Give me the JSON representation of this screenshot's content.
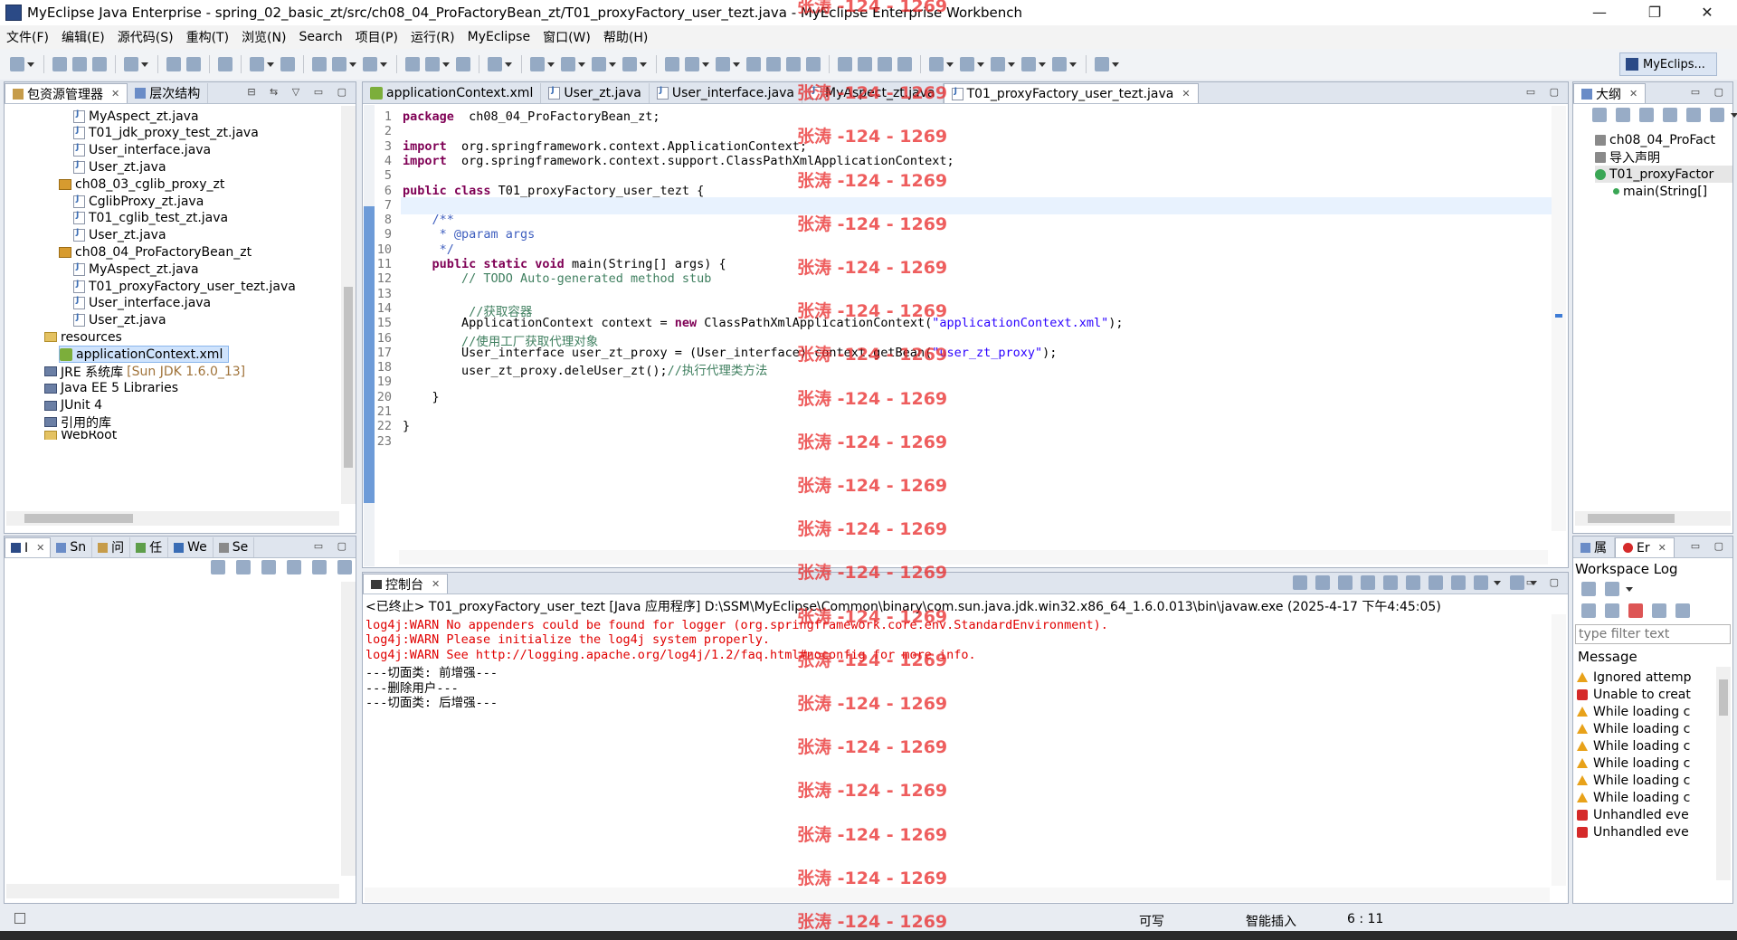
{
  "window": {
    "title": "MyEclipse Java Enterprise  -  spring_02_basic_zt/src/ch08_04_ProFactoryBean_zt/T01_proxyFactory_user_tezt.java  -  MyEclipse Enterprise Workbench",
    "minimize": "—",
    "restore": "❐",
    "close": "✕"
  },
  "menu": [
    "文件(F)",
    "编辑(E)",
    "源代码(S)",
    "重构(T)",
    "浏览(N)",
    "Search",
    "项目(P)",
    "运行(R)",
    "MyEclipse",
    "窗口(W)",
    "帮助(H)"
  ],
  "perspective": "MyEclips...",
  "explorer": {
    "tabs": [
      "包资源管理器",
      "层次结构"
    ],
    "items": [
      {
        "label": "MyAspect_zt.java",
        "type": "file",
        "indent": 2
      },
      {
        "label": "T01_jdk_proxy_test_zt.java",
        "type": "file",
        "indent": 2
      },
      {
        "label": "User_interface.java",
        "type": "file",
        "indent": 2
      },
      {
        "label": "User_zt.java",
        "type": "file",
        "indent": 2
      },
      {
        "label": "ch08_03_cglib_proxy_zt",
        "type": "pkg",
        "indent": 1
      },
      {
        "label": "CglibProxy_zt.java",
        "type": "file",
        "indent": 2
      },
      {
        "label": "T01_cglib_test_zt.java",
        "type": "file",
        "indent": 2
      },
      {
        "label": "User_zt.java",
        "type": "file",
        "indent": 2
      },
      {
        "label": "ch08_04_ProFactoryBean_zt",
        "type": "pkg",
        "indent": 1
      },
      {
        "label": "MyAspect_zt.java",
        "type": "file",
        "indent": 2
      },
      {
        "label": "T01_proxyFactory_user_tezt.java",
        "type": "file",
        "indent": 2
      },
      {
        "label": "User_interface.java",
        "type": "file",
        "indent": 2
      },
      {
        "label": "User_zt.java",
        "type": "file",
        "indent": 2
      },
      {
        "label": "resources",
        "type": "folder",
        "indent": 0
      },
      {
        "label": "applicationContext.xml",
        "type": "xml",
        "indent": 1,
        "selected": true
      },
      {
        "label": "JRE 系统库",
        "extra": "[Sun JDK 1.6.0_13]",
        "type": "lib",
        "indent": 0
      },
      {
        "label": "Java EE 5 Libraries",
        "type": "lib",
        "indent": 0
      },
      {
        "label": "JUnit 4",
        "type": "lib",
        "indent": 0
      },
      {
        "label": "引用的库",
        "type": "lib",
        "indent": 0
      },
      {
        "label": "WebRoot",
        "type": "folder",
        "indent": 0
      }
    ]
  },
  "bottomLeft": {
    "tabs": [
      "I",
      "Sn",
      "问",
      "任",
      "We",
      "Se"
    ]
  },
  "editor": {
    "tabs": [
      "applicationContext.xml",
      "User_zt.java",
      "User_interface.java",
      "MyAspect_zt.java",
      "T01_proxyFactory_user_tezt.java"
    ],
    "lines": [
      [
        [
          "kw",
          "package"
        ],
        [
          "",
          "  ch08_04_ProFactoryBean_zt;"
        ]
      ],
      [],
      [
        [
          "kw",
          "import"
        ],
        [
          "",
          "  org.springframework.context.ApplicationContext;"
        ]
      ],
      [
        [
          "kw",
          "import"
        ],
        [
          "",
          "  org.springframework.context.support.ClassPathXmlApplicationContext;"
        ]
      ],
      [],
      [
        [
          "kw",
          "public class"
        ],
        [
          "",
          " T01_proxyFactory_user_tezt {"
        ]
      ],
      [],
      [
        [
          "jd",
          "    /**"
        ]
      ],
      [
        [
          "jd",
          "     * @param args"
        ]
      ],
      [
        [
          "jd",
          "     */"
        ]
      ],
      [
        [
          "kw",
          "    public static void"
        ],
        [
          "",
          " main(String[] args) {"
        ]
      ],
      [
        [
          "cm",
          "        // TODO Auto-generated method stub"
        ]
      ],
      [],
      [
        [
          "cm",
          "         //获取容器"
        ]
      ],
      [
        [
          "",
          "        ApplicationContext context = "
        ],
        [
          "kw",
          "new"
        ],
        [
          "",
          " ClassPathXmlApplicationContext("
        ],
        [
          "str",
          "\"applicationContext.xml\""
        ],
        [
          "",
          ");"
        ]
      ],
      [
        [
          "cm",
          "        //使用工厂获取代理对象"
        ]
      ],
      [
        [
          "",
          "        User_interface user_zt_proxy = (User_interface) context.getBean("
        ],
        [
          "str",
          "\"user_zt_proxy\""
        ],
        [
          "",
          ");"
        ]
      ],
      [
        [
          "",
          "        user_zt_proxy.deleUser_zt();"
        ],
        [
          "cm",
          "//执行代理类方法"
        ]
      ],
      [],
      [
        [
          "",
          "    }"
        ]
      ],
      [],
      [
        [
          "",
          "}"
        ]
      ],
      []
    ]
  },
  "outline": {
    "tabs": [
      "大纲"
    ],
    "items": [
      "ch08_04_ProFact",
      "导入声明",
      "T01_proxyFactor",
      "main(String[]"
    ]
  },
  "console": {
    "tab": "控制台",
    "header": "<已终止> T01_proxyFactory_user_tezt [Java 应用程序] D:\\SSM\\MyEclipse\\Common\\binary\\com.sun.java.jdk.win32.x86_64_1.6.0.013\\bin\\javaw.exe  (2025-4-17 下午4:45:05)",
    "lines": [
      {
        "t": "log4j:WARN No appenders could be found for logger (org.springframework.core.env.StandardEnvironment).",
        "err": true
      },
      {
        "t": "log4j:WARN Please initialize the log4j system properly.",
        "err": true
      },
      {
        "t": "log4j:WARN See http://logging.apache.org/log4j/1.2/faq.html#noconfig for more info.",
        "err": true
      },
      {
        "t": "---切面类: 前增强---",
        "err": false
      },
      {
        "t": "---删除用户---",
        "err": false
      },
      {
        "t": "---切面类: 后增强---",
        "err": false
      }
    ]
  },
  "workspaceLog": {
    "tabs": [
      "属",
      "Er"
    ],
    "title": "Workspace Log",
    "filter_placeholder": "type filter text",
    "col": "Message",
    "rows": [
      {
        "t": "Ignored attemp",
        "k": "warn"
      },
      {
        "t": "Unable to creat",
        "k": "err"
      },
      {
        "t": "While loading c",
        "k": "warn"
      },
      {
        "t": "While loading c",
        "k": "warn"
      },
      {
        "t": "While loading c",
        "k": "warn"
      },
      {
        "t": "While loading c",
        "k": "warn"
      },
      {
        "t": "While loading c",
        "k": "warn"
      },
      {
        "t": "While loading c",
        "k": "warn"
      },
      {
        "t": "Unhandled eve",
        "k": "err"
      },
      {
        "t": "Unhandled eve",
        "k": "err"
      }
    ]
  },
  "watermark": "张涛 -124 - 1269",
  "status": {
    "writable": "可写",
    "insert": "智能插入",
    "pos": "6 : 11"
  }
}
